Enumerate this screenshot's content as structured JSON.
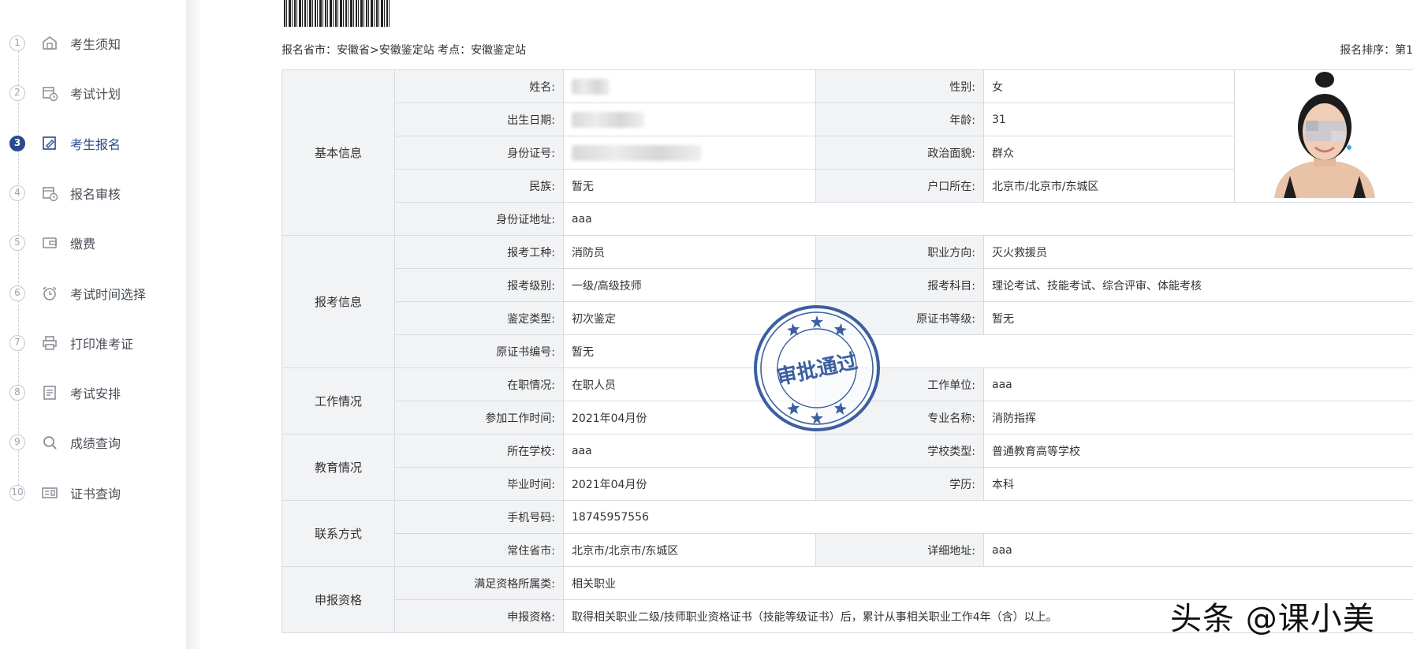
{
  "sidebar": {
    "steps": [
      {
        "num": "1",
        "label": "考生须知",
        "icon": "house-icon"
      },
      {
        "num": "2",
        "label": "考试计划",
        "icon": "calendar-clock-icon"
      },
      {
        "num": "3",
        "label": "考生报名",
        "icon": "edit-form-icon"
      },
      {
        "num": "4",
        "label": "报名审核",
        "icon": "calendar-clock-icon"
      },
      {
        "num": "5",
        "label": "缴费",
        "icon": "wallet-icon"
      },
      {
        "num": "6",
        "label": "考试时间选择",
        "icon": "alarm-clock-icon"
      },
      {
        "num": "7",
        "label": "打印准考证",
        "icon": "printer-icon"
      },
      {
        "num": "8",
        "label": "考试安排",
        "icon": "document-list-icon"
      },
      {
        "num": "9",
        "label": "成绩查询",
        "icon": "search-icon"
      },
      {
        "num": "10",
        "label": "证书查询",
        "icon": "certificate-icon"
      }
    ],
    "active_index": 2,
    "active_color": "#2b4a8a"
  },
  "header": {
    "meta": "报名省市：安徽省>安徽鉴定站  考点：安徽鉴定站",
    "rank": "报名排序：第1"
  },
  "sections": {
    "basic": "基本信息",
    "apply": "报考信息",
    "work": "工作情况",
    "edu": "教育情况",
    "contact": "联系方式",
    "qual": "申报资格"
  },
  "fields": {
    "name_label": "姓名:",
    "gender_label": "性别:",
    "gender": "女",
    "birth_label": "出生日期:",
    "age_label": "年龄:",
    "age": "31",
    "id_label": "身份证号:",
    "political_label": "政治面貌:",
    "political": "群众",
    "ethnic_label": "民族:",
    "ethnic": "暂无",
    "hukou_label": "户口所在:",
    "hukou": "北京市/北京市/东城区",
    "id_addr_label": "身份证地址:",
    "id_addr": "aaa",
    "job_type_label": "报考工种:",
    "job_type": "消防员",
    "direction_label": "职业方向:",
    "direction": "灭火救援员",
    "level_label": "报考级别:",
    "level": "一级/高级技师",
    "subjects_label": "报考科目:",
    "subjects": "理论考试、技能考试、综合评审、体能考核",
    "assess_label": "鉴定类型:",
    "assess": "初次鉴定",
    "orig_cert_level_label": "原证书等级:",
    "orig_cert_level": "暂无",
    "orig_cert_no_label": "原证书编号:",
    "orig_cert_no": "暂无",
    "employ_label": "在职情况:",
    "employ": "在职人员",
    "employer_label": "工作单位:",
    "employer": "aaa",
    "work_start_label": "参加工作时间:",
    "work_start": "2021年04月份",
    "major_label": "专业名称:",
    "major": "消防指挥",
    "school_label": "所在学校:",
    "school": "aaa",
    "school_type_label": "学校类型:",
    "school_type": "普通教育高等学校",
    "grad_label": "毕业时间:",
    "grad": "2021年04月份",
    "degree_label": "学历:",
    "degree": "本科",
    "phone_label": "手机号码:",
    "phone": "18745957556",
    "residence_label": "常住省市:",
    "residence": "北京市/北京市/东城区",
    "address_label": "详细地址:",
    "address": "aaa",
    "qual_cat_label": "满足资格所属类:",
    "qual_cat": "相关职业",
    "qual_label": "申报资格:",
    "qual": "取得相关职业二级/技师职业资格证书（技能等级证书）后，累计从事相关职业工作4年（含）以上。"
  },
  "stamp": {
    "text": "审批通过",
    "color": "#3b5fa0"
  },
  "watermark": "头条 @课小美"
}
